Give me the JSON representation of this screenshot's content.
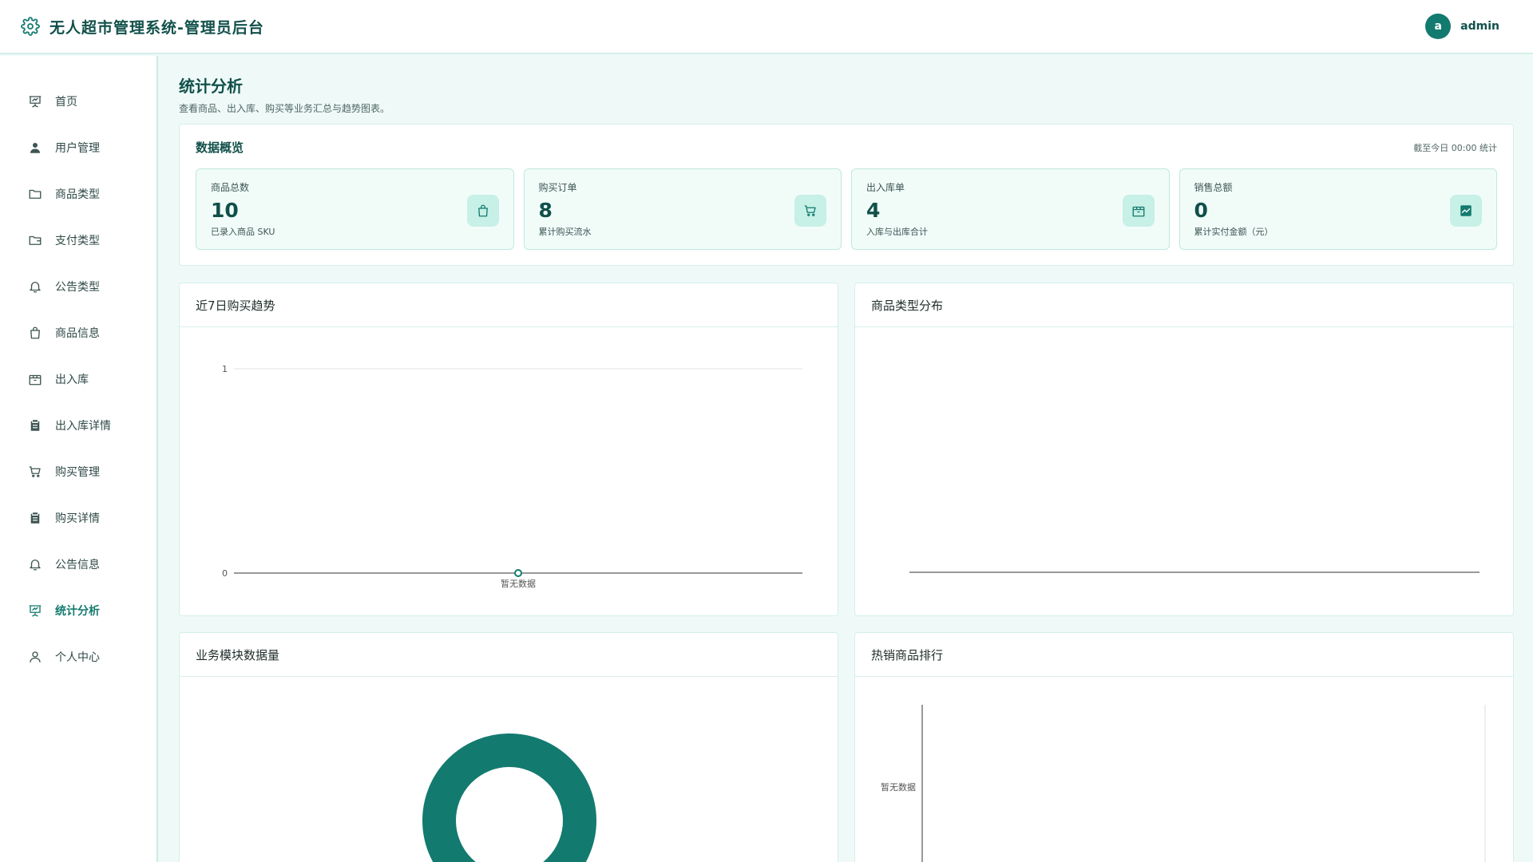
{
  "app": {
    "title": "无人超市管理系统-管理员后台",
    "user": {
      "avatar_letter": "a",
      "name": "admin"
    }
  },
  "sidebar": {
    "items": [
      {
        "label": "首页",
        "icon": "presentation-icon",
        "active": false
      },
      {
        "label": "用户管理",
        "icon": "user-icon",
        "active": false
      },
      {
        "label": "商品类型",
        "icon": "folder-icon",
        "active": false
      },
      {
        "label": "支付类型",
        "icon": "wallet-icon",
        "active": false
      },
      {
        "label": "公告类型",
        "icon": "bell-icon",
        "active": false
      },
      {
        "label": "商品信息",
        "icon": "shopping-bag-icon",
        "active": false
      },
      {
        "label": "出入库",
        "icon": "package-icon",
        "active": false
      },
      {
        "label": "出入库详情",
        "icon": "clipboard-icon",
        "active": false
      },
      {
        "label": "购买管理",
        "icon": "cart-icon",
        "active": false
      },
      {
        "label": "购买详情",
        "icon": "clipboard-icon",
        "active": false
      },
      {
        "label": "公告信息",
        "icon": "bell-icon",
        "active": false
      },
      {
        "label": "统计分析",
        "icon": "presentation-icon",
        "active": true
      },
      {
        "label": "个人中心",
        "icon": "user-outline-icon",
        "active": false
      }
    ]
  },
  "page": {
    "title": "统计分析",
    "description": "查看商品、出入库、购买等业务汇总与趋势图表。"
  },
  "overview": {
    "title": "数据概览",
    "note": "截至今日 00:00 统计",
    "cards": [
      {
        "label": "商品总数",
        "value": "10",
        "sub": "已录入商品 SKU",
        "icon": "shopping-bag-icon"
      },
      {
        "label": "购买订单",
        "value": "8",
        "sub": "累计购买流水",
        "icon": "cart-icon"
      },
      {
        "label": "出入库单",
        "value": "4",
        "sub": "入库与出库合计",
        "icon": "package-icon"
      },
      {
        "label": "销售总额",
        "value": "0",
        "sub": "累计实付金额（元）",
        "icon": "chart-line-icon"
      }
    ]
  },
  "panels": {
    "trend": {
      "title": "近7日购买趋势"
    },
    "category": {
      "title": "商品类型分布"
    },
    "modules": {
      "title": "业务模块数据量"
    },
    "hot": {
      "title": "热销商品排行"
    }
  },
  "chart_data": [
    {
      "type": "line",
      "title": "近7日购买趋势",
      "categories": [
        "暂无数据"
      ],
      "series": [
        {
          "values": [
            0
          ]
        }
      ],
      "ylim": [
        0,
        1
      ],
      "yticks": [
        "1",
        "0"
      ]
    },
    {
      "type": "pie",
      "title": "商品类型分布",
      "categories": [],
      "values": []
    },
    {
      "type": "pie",
      "title": "业务模块数据量",
      "categories": [],
      "values": [],
      "color": "#137a6f"
    },
    {
      "type": "bar",
      "title": "热销商品排行",
      "categories": [
        "暂无数据"
      ],
      "values": []
    }
  ]
}
